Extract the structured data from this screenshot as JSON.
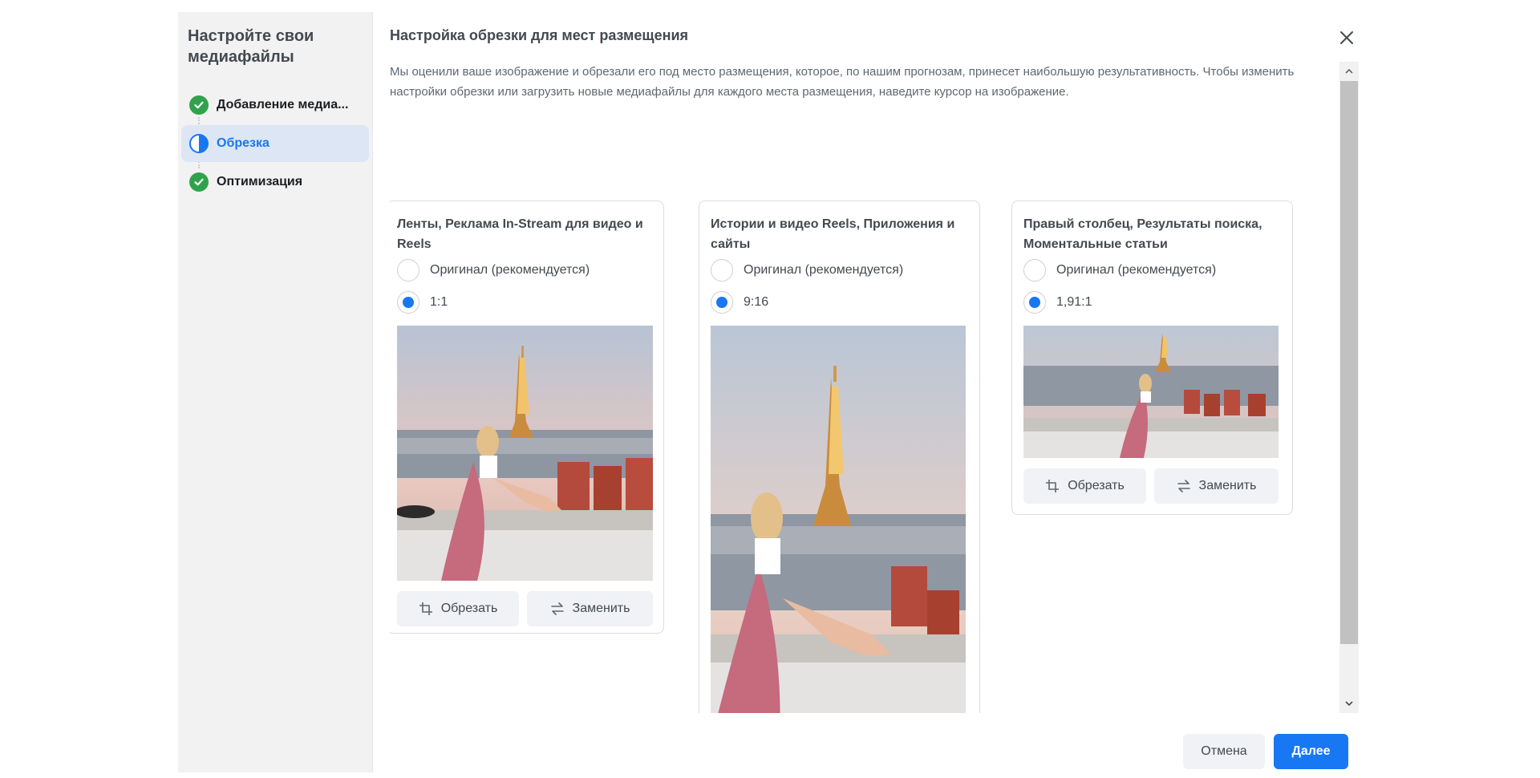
{
  "sidebar": {
    "title": "Настройте свои медиафайлы",
    "steps": [
      {
        "label": "Добавление медиа...",
        "status": "done"
      },
      {
        "label": "Обрезка",
        "status": "active"
      },
      {
        "label": "Оптимизация",
        "status": "done"
      }
    ]
  },
  "main": {
    "title": "Настройка обрезки для мест размещения",
    "description": "Мы оценили ваше изображение и обрезали его под место размещения, которое, по нашим прогнозам, принесет наибольшую результативность. Чтобы изменить настройки обрезки или загрузить новые медиафайлы для каждого места размещения, наведите курсор на изображение.",
    "cards": [
      {
        "title": "Ленты, Реклама In-Stream для видео и Reels",
        "option_original": "Оригинал (рекомендуется)",
        "option_ratio": "1:1",
        "selected": "ratio",
        "crop_label": "Обрезать",
        "replace_label": "Заменить"
      },
      {
        "title": "Истории и видео Reels, Приложения и сайты",
        "option_original": "Оригинал (рекомендуется)",
        "option_ratio": "9:16",
        "selected": "ratio"
      },
      {
        "title": "Правый столбец, Результаты поиска, Моментальные статьи",
        "option_original": "Оригинал (рекомендуется)",
        "option_ratio": "1,91:1",
        "selected": "ratio",
        "crop_label": "Обрезать",
        "replace_label": "Заменить"
      }
    ]
  },
  "footer": {
    "cancel_label": "Отмена",
    "next_label": "Далее"
  },
  "colors": {
    "accent": "#1877f2",
    "success": "#31a24c",
    "sidebar_bg": "#f2f2f2",
    "active_step_bg": "#dde6f5"
  },
  "icons": [
    "check-icon",
    "half-circle-icon",
    "close-icon",
    "crop-icon",
    "swap-icon",
    "chevron-up-icon",
    "chevron-down-icon"
  ]
}
